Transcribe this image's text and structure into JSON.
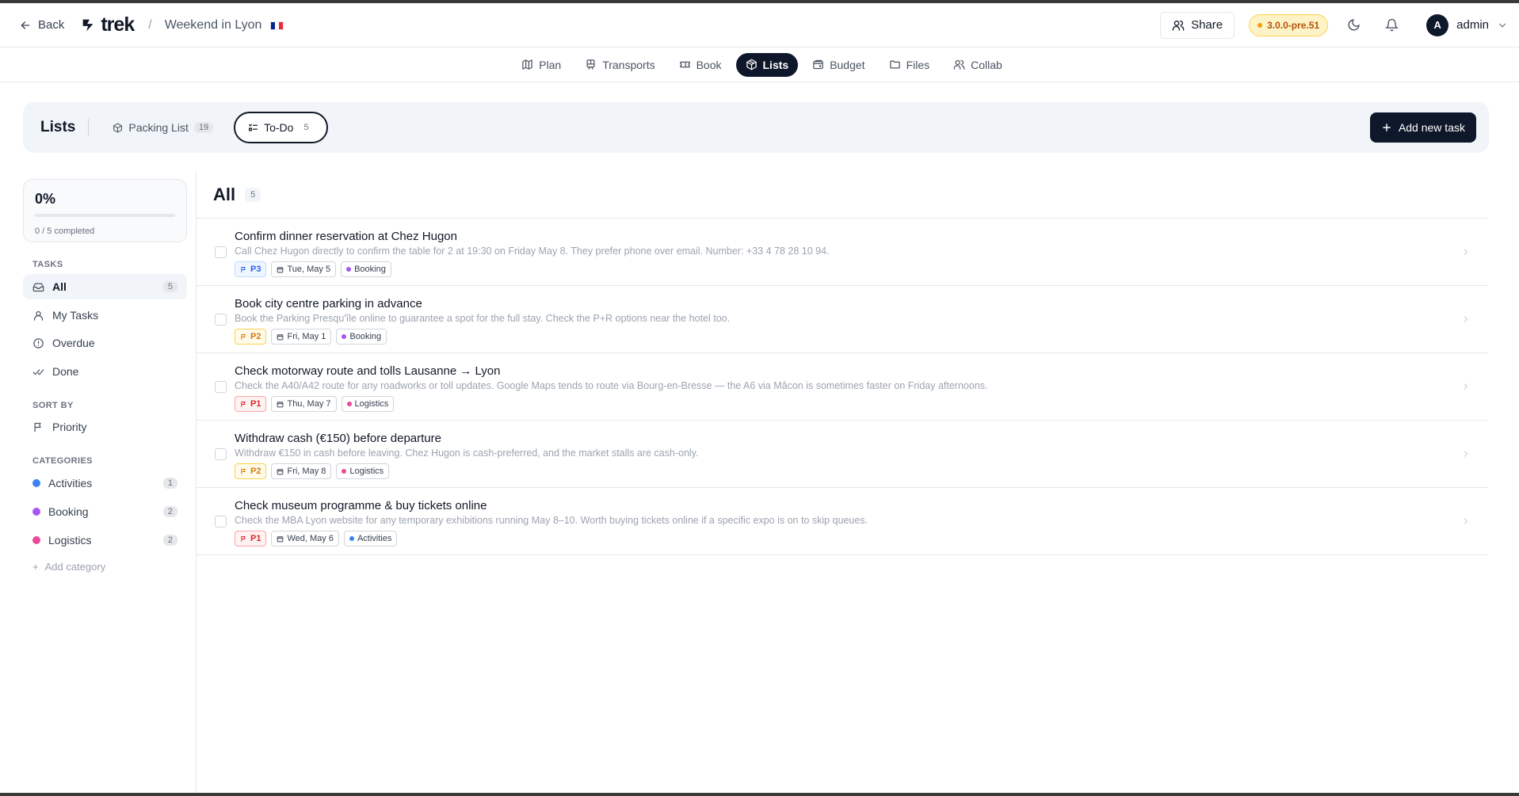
{
  "header": {
    "back_label": "Back",
    "logo_text": "trek",
    "breadcrumb_sep": "/",
    "trip_name": "Weekend in Lyon",
    "flag": [
      "#002395",
      "#ffffff",
      "#ed2939"
    ],
    "share_label": "Share",
    "version": "3.0.0-pre.51",
    "theme_icon": "moon-icon",
    "notifications_icon": "bell-icon",
    "user": {
      "initial": "A",
      "name": "admin"
    }
  },
  "nav": {
    "items": [
      {
        "label": "Plan",
        "icon": "map-icon"
      },
      {
        "label": "Transports",
        "icon": "train-icon"
      },
      {
        "label": "Book",
        "icon": "ticket-icon"
      },
      {
        "label": "Lists",
        "icon": "package-icon",
        "active": true
      },
      {
        "label": "Budget",
        "icon": "wallet-icon"
      },
      {
        "label": "Files",
        "icon": "folder-icon"
      },
      {
        "label": "Collab",
        "icon": "users-icon"
      }
    ]
  },
  "lists": {
    "title": "Lists",
    "tabs": [
      {
        "label": "Packing List",
        "count": "19"
      },
      {
        "label": "To-Do",
        "count": "5",
        "active": true
      }
    ],
    "add_task_label": "Add new task"
  },
  "sidebar": {
    "progress": {
      "percent_label": "0%",
      "fraction": 0,
      "completed_label": "0 / 5 completed"
    },
    "tasks_title": "TASKS",
    "filters": [
      {
        "label": "All",
        "count": "5",
        "active": true,
        "icon": "inbox-icon"
      },
      {
        "label": "My Tasks",
        "icon": "user-icon"
      },
      {
        "label": "Overdue",
        "icon": "alert-circle-icon"
      },
      {
        "label": "Done",
        "icon": "check-check-icon"
      }
    ],
    "sort_title": "SORT BY",
    "sort_label": "Priority",
    "categories_title": "CATEGORIES",
    "categories": [
      {
        "label": "Activities",
        "count": "1",
        "color": "#3b82f6"
      },
      {
        "label": "Booking",
        "count": "2",
        "color": "#a855f7"
      },
      {
        "label": "Logistics",
        "count": "2",
        "color": "#ec4899"
      }
    ],
    "add_category_label": "Add category"
  },
  "main": {
    "title": "All",
    "count": "5",
    "tasks": [
      {
        "title": "Confirm dinner reservation at Chez Hugon",
        "desc": "Call Chez Hugon directly to confirm the table for 2 at 19:30 on Friday May 8. They prefer phone over email. Number: +33 4 78 28 10 94.",
        "priority": "P3",
        "priority_color": "#2563eb",
        "priority_bg": "#eff6ff",
        "priority_border": "#bfdbfe",
        "date": "Tue, May 5",
        "category": "Booking",
        "category_color": "#a855f7"
      },
      {
        "title": "Book city centre parking in advance",
        "desc": "Book the Parking Presqu'île online to guarantee a spot for the full stay. Check the P+R options near the hotel too.",
        "priority": "P2",
        "priority_color": "#d97706",
        "priority_bg": "#fffbeb",
        "priority_border": "#fcd34d",
        "date": "Fri, May 1",
        "category": "Booking",
        "category_color": "#a855f7"
      },
      {
        "title": "Check motorway route and tolls Lausanne → Lyon",
        "desc": "Check the A40/A42 route for any roadworks or toll updates. Google Maps tends to route via Bourg-en-Bresse — the A6 via Mâcon is sometimes faster on Friday afternoons.",
        "priority": "P1",
        "priority_color": "#dc2626",
        "priority_bg": "#fef2f2",
        "priority_border": "#fca5a5",
        "date": "Thu, May 7",
        "category": "Logistics",
        "category_color": "#ec4899"
      },
      {
        "title": "Withdraw cash (€150) before departure",
        "desc": "Withdraw €150 in cash before leaving. Chez Hugon is cash-preferred, and the market stalls are cash-only.",
        "priority": "P2",
        "priority_color": "#d97706",
        "priority_bg": "#fffbeb",
        "priority_border": "#fcd34d",
        "date": "Fri, May 8",
        "category": "Logistics",
        "category_color": "#ec4899"
      },
      {
        "title": "Check museum programme & buy tickets online",
        "desc": "Check the MBA Lyon website for any temporary exhibitions running May 8–10. Worth buying tickets online if a specific expo is on to skip queues.",
        "priority": "P1",
        "priority_color": "#dc2626",
        "priority_bg": "#fef2f2",
        "priority_border": "#fca5a5",
        "date": "Wed, May 6",
        "category": "Activities",
        "category_color": "#3b82f6"
      }
    ]
  }
}
